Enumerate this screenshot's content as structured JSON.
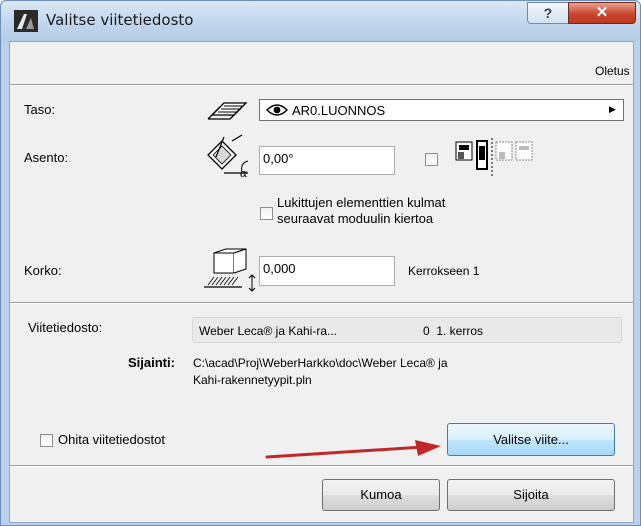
{
  "window": {
    "title": "Valitse viitetiedosto",
    "help_glyph": "?",
    "close_glyph": "✕"
  },
  "header": {
    "defaults_link": "Oletus"
  },
  "layer": {
    "label": "Taso:",
    "value": "AR0.LUONNOS",
    "icon": "layer-settings-icon"
  },
  "orientation": {
    "label": "Asento:",
    "value": "0,00°",
    "lock_label": "Lukittujen elementtien kulmat\nseuraavat moduulin kiertoa"
  },
  "height": {
    "label": "Korko:",
    "value": "0,000",
    "relative_to": "Kerrokseen 1"
  },
  "reference_file": {
    "label": "Viitetiedosto:",
    "name": "Weber Leca® ja Kahi-ra...",
    "story": "0  1. kerros",
    "location_label": "Sijainti:",
    "location_line1": "C:\\acad\\Proj\\WeberHarkko\\doc\\Weber Leca® ja",
    "location_line2": "Kahi-rakennetyypit.pln"
  },
  "skip_refs": {
    "label": "Ohita viitetiedostot",
    "checked": false
  },
  "buttons": {
    "choose_ref": "Valitse viite...",
    "cancel": "Kumoa",
    "place": "Sijoita"
  },
  "colors": {
    "arrow": "#c0282a",
    "titlebar": "#c3d8ee",
    "close": "#c8462f"
  }
}
